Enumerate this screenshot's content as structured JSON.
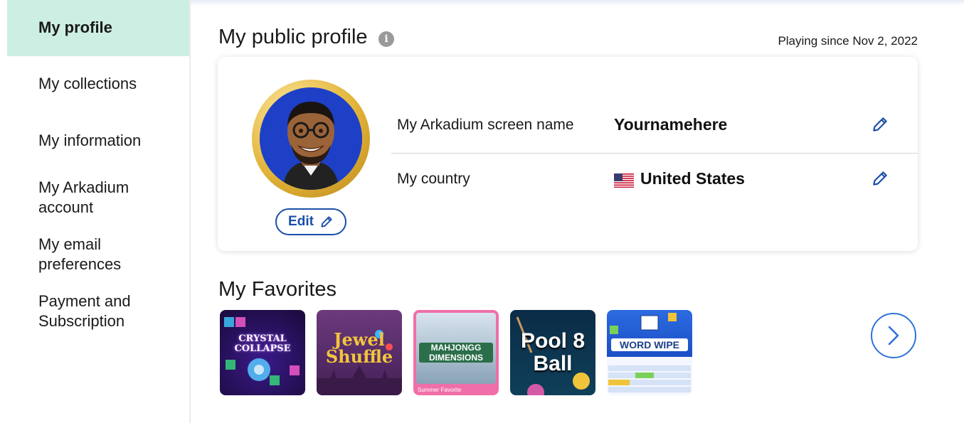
{
  "sidebar": {
    "items": [
      {
        "label": "My profile"
      },
      {
        "label": "My collections"
      },
      {
        "label": "My information"
      },
      {
        "label": "My Arkadium account"
      },
      {
        "label": "My email preferences"
      },
      {
        "label": "Payment and Subscription"
      }
    ]
  },
  "profile": {
    "title": "My public profile",
    "playing_since": "Playing since Nov 2, 2022",
    "edit_label": "Edit",
    "screen_name_label": "My Arkadium screen name",
    "screen_name_value": "Yournamehere",
    "country_label": "My country",
    "country_value": "United States"
  },
  "favorites": {
    "title": "My Favorites",
    "games": [
      {
        "name": "CRYSTAL COLLAPSE"
      },
      {
        "name": "Jewel Shuffle"
      },
      {
        "name": "MAHJONGG DIMENSIONS",
        "badge": "Summer Favorite"
      },
      {
        "name": "Pool 8 Ball"
      },
      {
        "name": "WORD WIPE"
      }
    ]
  },
  "colors": {
    "active_nav": "#cdeee3",
    "accent_blue": "#1b4fa8",
    "gold": "#e2b43a"
  }
}
